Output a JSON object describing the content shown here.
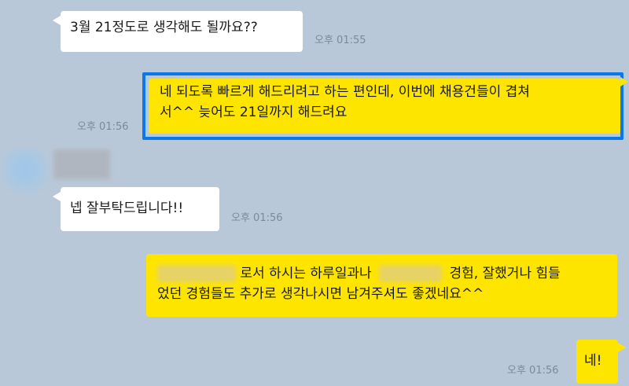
{
  "messages": [
    {
      "id": "m1",
      "direction": "in",
      "text": "3월 21정도로 생각해도 될까요??",
      "time": "오후 01:55"
    },
    {
      "id": "m2",
      "direction": "out",
      "line1": "네 되도록 빠르게 해드리려고 하는 편인데, 이번에 채용건들이 겹쳐",
      "line2": "서^^ 늦어도 21일까지 해드려요",
      "time": "오후 01:56",
      "highlighted": true
    },
    {
      "id": "m3",
      "direction": "in",
      "text": "넵 잘부탁드립니다!!",
      "time": "오후 01:56"
    },
    {
      "id": "m4",
      "direction": "out",
      "line1_part1": "로서 하시는 하루일과나",
      "line1_part2": "경험, 잘했거나 힘들",
      "line2": "었던 경험들도 추가로 생각나시면 남겨주셔도 좋겠네요^^",
      "time": ""
    },
    {
      "id": "m5",
      "direction": "out",
      "text": "네!",
      "time": "오후 01:56"
    }
  ],
  "colors": {
    "background": "#b9c8d9",
    "incoming_bubble": "#ffffff",
    "outgoing_bubble": "#fee500",
    "highlight": "#0a78e6",
    "timestamp": "#7b8a9b"
  }
}
